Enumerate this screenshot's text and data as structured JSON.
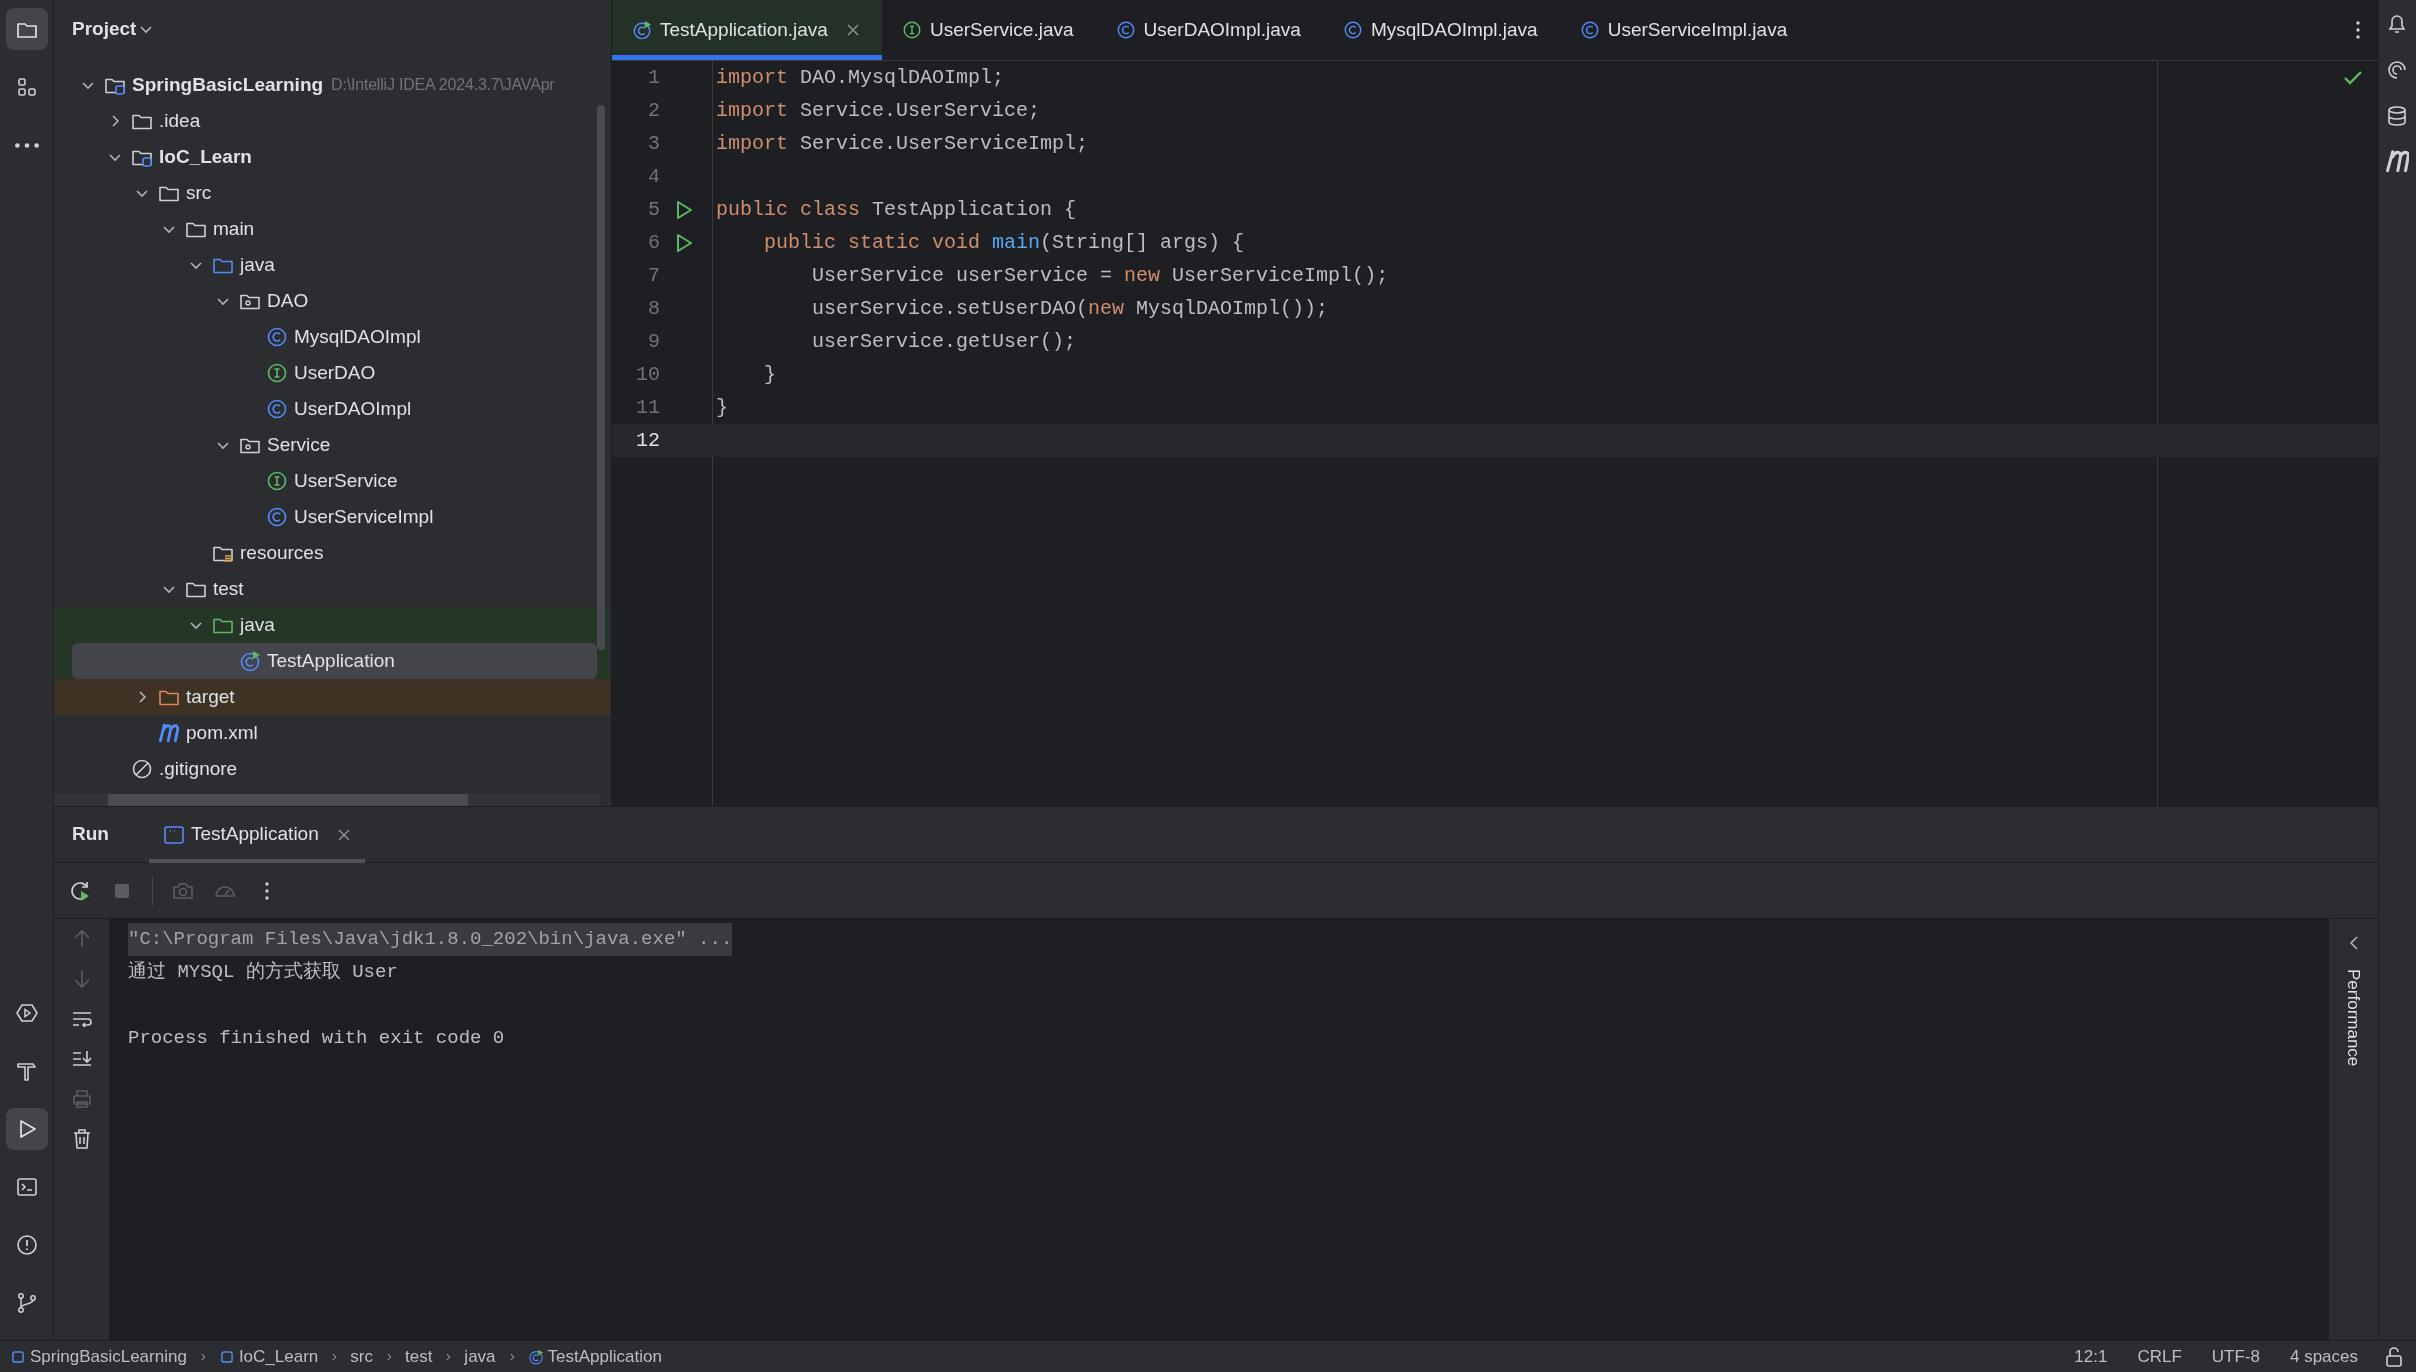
{
  "tool_strip": {
    "top": [
      {
        "kind": "project",
        "selected": true
      },
      {
        "kind": "structure",
        "selected": false
      },
      {
        "kind": "more",
        "selected": false
      }
    ],
    "bottom": [
      {
        "kind": "services",
        "selected": false
      },
      {
        "kind": "build",
        "selected": false
      },
      {
        "kind": "run",
        "selected": true
      },
      {
        "kind": "terminal",
        "selected": false
      },
      {
        "kind": "problems",
        "selected": false
      },
      {
        "kind": "git",
        "selected": false
      }
    ]
  },
  "project_panel": {
    "title": "Project",
    "tree": [
      {
        "label": "SpringBasicLearning",
        "path": "D:\\IntelliJ IDEA 2024.3.7\\JAVApr",
        "kind": "module",
        "expanded": true,
        "selected": false,
        "children": [
          {
            "label": ".idea",
            "kind": "folder",
            "expanded": false,
            "selected": false
          },
          {
            "label": "IoC_Learn",
            "kind": "module",
            "expanded": true,
            "selected": false,
            "children": [
              {
                "label": "src",
                "kind": "folder",
                "expanded": true,
                "selected": false,
                "children": [
                  {
                    "label": "main",
                    "kind": "folder",
                    "expanded": true,
                    "selected": false,
                    "children": [
                      {
                        "label": "java",
                        "kind": "source-root",
                        "expanded": true,
                        "selected": false,
                        "children": [
                          {
                            "label": "DAO",
                            "kind": "package",
                            "expanded": true,
                            "selected": false,
                            "children": [
                              {
                                "label": "MysqlDAOImpl",
                                "kind": "class",
                                "selected": false
                              },
                              {
                                "label": "UserDAO",
                                "kind": "interface",
                                "selected": false
                              },
                              {
                                "label": "UserDAOImpl",
                                "kind": "class",
                                "selected": false
                              }
                            ]
                          },
                          {
                            "label": "Service",
                            "kind": "package",
                            "expanded": true,
                            "selected": false,
                            "children": [
                              {
                                "label": "UserService",
                                "kind": "interface",
                                "selected": false
                              },
                              {
                                "label": "UserServiceImpl",
                                "kind": "class",
                                "selected": false
                              }
                            ]
                          }
                        ]
                      },
                      {
                        "label": "resources",
                        "kind": "resources",
                        "selected": false
                      }
                    ]
                  },
                  {
                    "label": "test",
                    "kind": "folder",
                    "expanded": true,
                    "selected": false,
                    "children": [
                      {
                        "label": "java",
                        "kind": "test-root",
                        "expanded": true,
                        "selected": false,
                        "children": [
                          {
                            "label": "TestApplication",
                            "kind": "test-class",
                            "selected": true
                          }
                        ]
                      }
                    ]
                  }
                ]
              },
              {
                "label": "target",
                "kind": "excluded",
                "expanded": false,
                "selected": false
              },
              {
                "label": "pom.xml",
                "kind": "maven",
                "selected": false
              }
            ]
          },
          {
            "label": ".gitignore",
            "kind": "ignore",
            "selected": false
          }
        ]
      }
    ]
  },
  "editor": {
    "tabs": [
      {
        "label": "TestApplication.java",
        "kind": "test-class",
        "selected": true
      },
      {
        "label": "UserService.java",
        "kind": "interface",
        "selected": false
      },
      {
        "label": "UserDAOImpl.java",
        "kind": "class",
        "selected": false
      },
      {
        "label": "MysqlDAOImpl.java",
        "kind": "class",
        "selected": false
      },
      {
        "label": "UserServiceImpl.java",
        "kind": "class",
        "selected": false
      }
    ],
    "inspection_ok": true,
    "lines": [
      {
        "number": "1",
        "run_marker": false,
        "current": false,
        "tokens": [
          {
            "kind": "keyword",
            "text": "import "
          },
          {
            "kind": "plain",
            "text": "DAO.MysqlDAOImpl;"
          }
        ]
      },
      {
        "number": "2",
        "run_marker": false,
        "current": false,
        "tokens": [
          {
            "kind": "keyword",
            "text": "import "
          },
          {
            "kind": "plain",
            "text": "Service.UserService;"
          }
        ]
      },
      {
        "number": "3",
        "run_marker": false,
        "current": false,
        "tokens": [
          {
            "kind": "keyword",
            "text": "import "
          },
          {
            "kind": "plain",
            "text": "Service.UserServiceImpl;"
          }
        ]
      },
      {
        "number": "4",
        "run_marker": false,
        "current": false
      },
      {
        "number": "5",
        "run_marker": true,
        "current": false,
        "tokens": [
          {
            "kind": "keyword",
            "text": "public class "
          },
          {
            "kind": "plain",
            "text": "TestApplication {"
          }
        ]
      },
      {
        "number": "6",
        "run_marker": true,
        "current": false,
        "tokens": [
          {
            "kind": "keyword",
            "text": "    public static void "
          },
          {
            "kind": "method",
            "text": "main"
          },
          {
            "kind": "plain",
            "text": "(String[] args) {"
          }
        ]
      },
      {
        "number": "7",
        "run_marker": false,
        "current": false,
        "tokens": [
          {
            "kind": "plain",
            "text": "        UserService userService = "
          },
          {
            "kind": "keyword",
            "text": "new "
          },
          {
            "kind": "plain",
            "text": "UserServiceImpl();"
          }
        ]
      },
      {
        "number": "8",
        "run_marker": false,
        "current": false,
        "tokens": [
          {
            "kind": "plain",
            "text": "        userService.setUserDAO("
          },
          {
            "kind": "keyword",
            "text": "new "
          },
          {
            "kind": "plain",
            "text": "MysqlDAOImpl());"
          }
        ]
      },
      {
        "number": "9",
        "run_marker": false,
        "current": false,
        "tokens": [
          {
            "kind": "plain",
            "text": "        userService.getUser();"
          }
        ]
      },
      {
        "number": "10",
        "run_marker": false,
        "current": false,
        "tokens": [
          {
            "kind": "plain",
            "text": "    }"
          }
        ]
      },
      {
        "number": "11",
        "run_marker": false,
        "current": false,
        "tokens": [
          {
            "kind": "plain",
            "text": "}"
          }
        ]
      },
      {
        "number": "12",
        "run_marker": false,
        "current": true
      }
    ]
  },
  "run_panel": {
    "title": "Run",
    "tabs": [
      {
        "label": "TestApplication",
        "selected": true
      }
    ],
    "console": [
      {
        "kind": "command",
        "text": "\"C:\\Program Files\\Java\\jdk1.8.0_202\\bin\\java.exe\" ..."
      },
      {
        "kind": "output",
        "text": "通过 MYSQL 的方式获取 User"
      },
      {
        "kind": "status",
        "text": "Process finished with exit code 0"
      }
    ],
    "side_tab": "Performance"
  },
  "status_bar": {
    "breadcrumbs": [
      {
        "label": "SpringBasicLearning",
        "kind": "module"
      },
      {
        "label": "IoC_Learn",
        "kind": "module"
      },
      {
        "label": "src",
        "kind": "folder"
      },
      {
        "label": "test",
        "kind": "folder"
      },
      {
        "label": "java",
        "kind": "folder"
      },
      {
        "label": "TestApplication",
        "kind": "test-class"
      }
    ],
    "items": [
      "12:1",
      "CRLF",
      "UTF-8",
      "4 spaces"
    ]
  }
}
